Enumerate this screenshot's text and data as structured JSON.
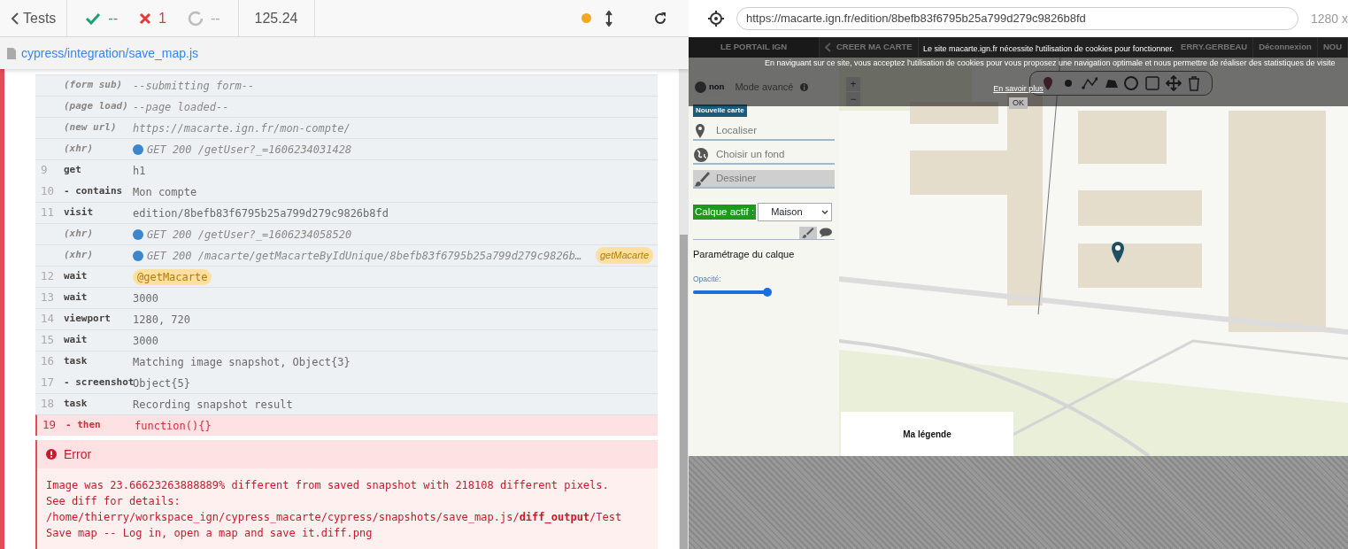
{
  "header": {
    "back_label": "Tests",
    "passed": "--",
    "failed": "1",
    "pending": "--",
    "duration": "125.24",
    "running": true
  },
  "spec": {
    "path": "cypress/integration/save_map.js"
  },
  "commands": [
    {
      "kind": "event",
      "name": "(form sub)",
      "message": "--submitting form--"
    },
    {
      "kind": "event",
      "name": "(page load)",
      "message": "--page loaded--"
    },
    {
      "kind": "event",
      "name": "(new url)",
      "message": "https://macarte.ign.fr/mon-compte/"
    },
    {
      "kind": "xhr",
      "name": "(xhr)",
      "message": "GET 200 /getUser?_=1606234031428"
    },
    {
      "kind": "command",
      "number": "9",
      "name": "get",
      "message": "h1"
    },
    {
      "kind": "child",
      "number": "10",
      "name": "- contains",
      "message": "Mon compte"
    },
    {
      "kind": "command",
      "number": "11",
      "name": "visit",
      "message": "edition/8befb83f6795b25a799d279c9826b8fd"
    },
    {
      "kind": "xhr",
      "name": "(xhr)",
      "message": "GET 200 /getUser?_=1606234058520"
    },
    {
      "kind": "xhr",
      "name": "(xhr)",
      "message": "GET 200 /macarte/getMacarteByIdUnique/8befb83f6795b25a799d279c9826b…",
      "alias": "getMacarte"
    },
    {
      "kind": "alias",
      "number": "12",
      "name": "wait",
      "message": "@getMacarte"
    },
    {
      "kind": "command",
      "number": "13",
      "name": "wait",
      "message": "3000"
    },
    {
      "kind": "command",
      "number": "14",
      "name": "viewport",
      "message": "1280, 720"
    },
    {
      "kind": "command",
      "number": "15",
      "name": "wait",
      "message": "3000"
    },
    {
      "kind": "command",
      "number": "16",
      "name": "task",
      "message": "Matching image snapshot, Object{3}"
    },
    {
      "kind": "child",
      "number": "17",
      "name": "- screenshot",
      "message": "Object{5}"
    },
    {
      "kind": "command",
      "number": "18",
      "name": "task",
      "message": "Recording snapshot result"
    },
    {
      "kind": "failed",
      "number": "19",
      "name": "- then",
      "message": "function(){}"
    }
  ],
  "error": {
    "title": "Error",
    "message_lines": [
      "Image was 23.66623263888889% different from saved snapshot with 218108 different pixels.",
      "See diff for details:",
      "/home/thierry/workspace_ign/cypress_macarte/cypress/snapshots/save_map.js/**diff_output**/Test",
      "Save map -- Log in, open a map and save it.diff.png"
    ]
  },
  "preview": {
    "url": "https://macarte.ign.fr/edition/8befb83f6795b25a799d279c9826b8fd",
    "viewport": "1280 x"
  },
  "app": {
    "nav": [
      {
        "kind": "portal",
        "label": "LE PORTAIL IGN"
      },
      {
        "kind": "back",
        "label": "CREER MA CARTE"
      },
      {
        "kind": "user",
        "label": "ERRY.GERBEAU"
      },
      {
        "kind": "link",
        "label": "Déconnexion"
      },
      {
        "kind": "link",
        "label": "NOU"
      }
    ],
    "cookie": {
      "line_1": "Le site macarte.ign.fr nécessite l'utilisation de cookies pour fonctionner.",
      "line_2": "En naviguant sur ce site, vous acceptez l'utilisation de cookies pour vous proposez une navigation optimale et nous permettre de réaliser des statistiques de visite",
      "link": "En savoir plus",
      "button": "OK"
    },
    "advanced_mode": {
      "on": false,
      "label": "non",
      "text": "Mode avancé"
    },
    "zoom": [
      "+",
      "−"
    ],
    "new_map": "Nouvelle carte",
    "menu": [
      {
        "kind": "locate",
        "label": "Localiser",
        "selected": false
      },
      {
        "kind": "background",
        "label": "Choisir un fond",
        "selected": false
      },
      {
        "kind": "draw",
        "label": "Dessiner",
        "selected": true
      }
    ],
    "layer": {
      "label": "Calque actif :",
      "value": "Maison"
    },
    "layer_tabs": [
      {
        "kind": "style",
        "selected": true
      },
      {
        "kind": "comment",
        "selected": false
      }
    ],
    "settings_title": "Paramétrage du calque",
    "opacity": {
      "label": "Opacité:",
      "level": 1
    },
    "legend": "Ma légende"
  }
}
